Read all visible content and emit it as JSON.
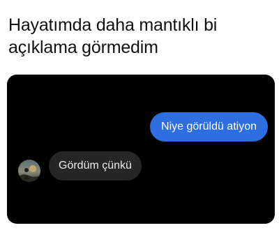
{
  "caption": {
    "text": "Hayatımda daha mantıklı bi açıklama görmedim"
  },
  "chat": {
    "sent_message": "Niye görüldü atiyon",
    "received_message": "Gördüm çünkü",
    "sent_bubble_color": "#2d6fe0",
    "received_bubble_color": "#262626",
    "background_color": "#000000"
  },
  "avatar": {
    "icon": "profile-photo-avatar"
  }
}
